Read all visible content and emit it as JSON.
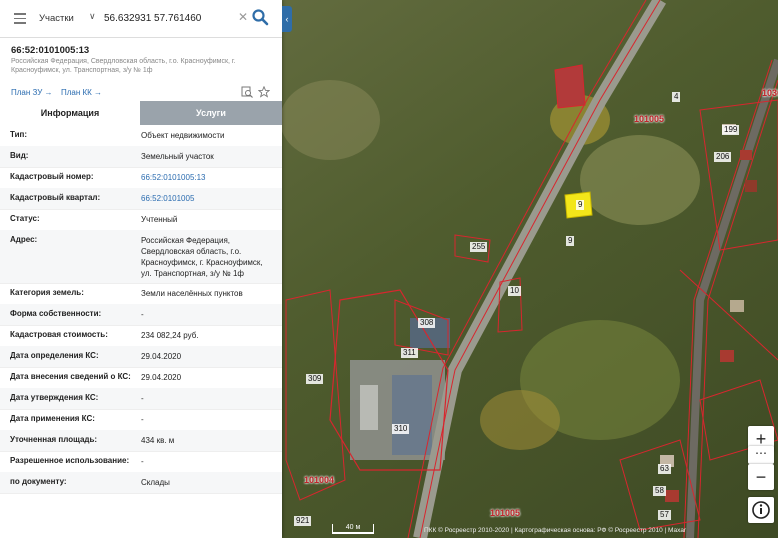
{
  "search": {
    "type_label": "Участки",
    "query": "56.632931 57.761460"
  },
  "parcel": {
    "number": "66:52:0101005:13",
    "address_line": "Российская Федерация, Свердловская область, г.о. Красноуфимск, г. Красноуфимск, ул. Транспортная, з/у № 1ф"
  },
  "links": {
    "plan_zu": "План ЗУ →",
    "plan_kk": "План КК →"
  },
  "tabs": {
    "info": "Информация",
    "services": "Услуги"
  },
  "rows": [
    {
      "key": "Тип:",
      "value": "Объект недвижимости"
    },
    {
      "key": "Вид:",
      "value": "Земельный участок"
    },
    {
      "key": "Кадастровый номер:",
      "value": "66:52:0101005:13"
    },
    {
      "key": "Кадастровый квартал:",
      "value": "66:52:0101005"
    },
    {
      "key": "Статус:",
      "value": "Учтенный"
    },
    {
      "key": "Адрес:",
      "value": "Российская Федерация, Свердловская область, г.о. Красноуфимск, г. Красноуфимск, ул. Транспортная, з/у № 1ф"
    },
    {
      "key": "Категория земель:",
      "value": "Земли населённых пунктов"
    },
    {
      "key": "Форма собственности:",
      "value": "-"
    },
    {
      "key": "Кадастровая стоимость:",
      "value": "234 082,24 руб."
    },
    {
      "key": "Дата определения КС:",
      "value": "29.04.2020"
    },
    {
      "key": "Дата внесения сведений о КС:",
      "value": "29.04.2020"
    },
    {
      "key": "Дата утверждения КС:",
      "value": "-"
    },
    {
      "key": "Дата применения КС:",
      "value": "-"
    },
    {
      "key": "Уточненная площадь:",
      "value": "434 кв. м"
    },
    {
      "key": "Разрешенное использование:",
      "value": "-"
    },
    {
      "key": "по документу:",
      "value": "Склады"
    }
  ],
  "map": {
    "labels": {
      "l308": "308",
      "l311": "311",
      "l309": "309",
      "l310": "310",
      "l921": "921",
      "l9": "9",
      "l9b": "9",
      "l10": "10",
      "l255": "255",
      "l199": "199",
      "l206": "206",
      "l4": "4",
      "l63": "63",
      "l58": "58",
      "l57": "57"
    },
    "quarters": {
      "q1": "101005",
      "q2": "101004",
      "q3": "101005",
      "q4": "1036"
    },
    "scale": "40 м",
    "attribution": "ПКК © Росреестр 2010-2020 | Картографическая основа: РФ © Росреестр 2010 | Maxar"
  },
  "controls": {
    "zoom_in": "+",
    "zoom_out": "−"
  },
  "colors": {
    "accent": "#2f6da8",
    "parcel_border": "#d8262e",
    "selected_parcel": "#f3e61a"
  }
}
